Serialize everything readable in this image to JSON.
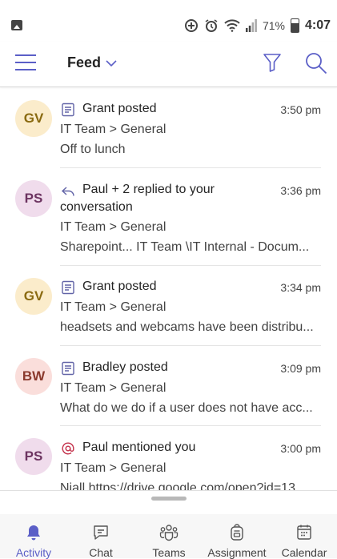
{
  "status": {
    "battery": "71%",
    "time": "4:07"
  },
  "header": {
    "title": "Feed"
  },
  "feed": [
    {
      "initials": "GV",
      "icon": "post-icon",
      "title": "Grant posted",
      "time": "3:50 pm",
      "lines": [
        "IT Team  > General",
        "Off to lunch"
      ]
    },
    {
      "initials": "PS",
      "icon": "reply-icon",
      "title": "Paul + 2 replied to your",
      "time": "3:36 pm",
      "lines": [
        "conversation",
        "IT Team  > General",
        "Sharepoint... IT Team \\IT Internal - Docum..."
      ]
    },
    {
      "initials": "GV",
      "icon": "post-icon",
      "title": "Grant posted",
      "time": "3:34 pm",
      "lines": [
        "IT Team  > General",
        "headsets and webcams have been distribu..."
      ]
    },
    {
      "initials": "BW",
      "icon": "post-icon",
      "title": "Bradley posted",
      "time": "3:09 pm",
      "lines": [
        "IT Team  > General",
        "What do we do if a user does not have acc..."
      ]
    },
    {
      "initials": "PS",
      "icon": "mention-icon",
      "title": "Paul mentioned you",
      "time": "3:00 pm",
      "lines": [
        "IT Team  > General",
        "Niall https://drive.google.com/open?id=13"
      ]
    }
  ],
  "tabs": [
    {
      "label": "Activity",
      "icon": "bell-icon",
      "active": true
    },
    {
      "label": "Chat",
      "icon": "chat-icon",
      "active": false
    },
    {
      "label": "Teams",
      "icon": "teams-icon",
      "active": false
    },
    {
      "label": "Assignment",
      "icon": "backpack-icon",
      "active": false
    },
    {
      "label": "Calendar",
      "icon": "calendar-icon",
      "active": false
    }
  ],
  "colors": {
    "accent": "#5b5fc7",
    "icon": "#6264a7"
  }
}
